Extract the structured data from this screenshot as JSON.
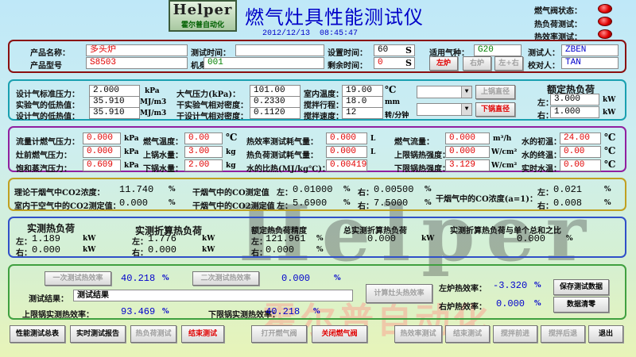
{
  "header": {
    "logo_text": "Helper",
    "logo_cn": "霍尔普自动化",
    "title": "燃气灶具性能测试仪",
    "datetime": "2012/12/13  08:45:47",
    "status": [
      "燃气阀状态：",
      "热负荷测试：",
      "热效率测试："
    ]
  },
  "info": {
    "product_name_label": "产品名称：",
    "product_name": "多头炉",
    "product_model_label": "产品型号",
    "product_model": "S8503",
    "test_time_label": "测试时间：",
    "test_time": "",
    "machine_no_label": "机身编号：",
    "machine_no": "001",
    "set_time_label": "设置时间：",
    "set_time": "60",
    "set_time_unit": "S",
    "remain_time_label": "剩余时间：",
    "remain_time": "0",
    "remain_time_unit": "S",
    "gas_label": "适用气种：",
    "gas": "G20",
    "tester_label": "测试人：",
    "tester": "ZBEN",
    "checker_label": "校对人：",
    "checker": "TAN",
    "btn_left": "左炉",
    "btn_right": "右炉",
    "btn_both": "左+右"
  },
  "params": {
    "design_pressure_label": "设计气标准压力：",
    "design_pressure": "2.000",
    "design_pressure_unit": "kPa",
    "exp_calorific_label": "实验气的低热值：",
    "exp_calorific": "35.910",
    "exp_calorific_unit": "MJ/m3",
    "design_calorific_label": "设计气的低热值：",
    "design_calorific": "35.910",
    "design_calorific_unit": "MJ/m3",
    "atm_label": "大气压力(kPa)：",
    "atm": "101.00",
    "dry_exp_density_label": "干实验气相对密度：",
    "dry_exp_density": "0.2330",
    "dry_design_density_label": "干设计气相对密度：",
    "dry_design_density": "0.1120",
    "room_temp_label": "室内温度：",
    "room_temp": "19.00",
    "room_temp_unit": "℃",
    "stir_travel_label": "搅拌行程：",
    "stir_travel": "18.0",
    "stir_travel_unit": "mm",
    "stir_speed_label": "搅拌速度：",
    "stir_speed": "12",
    "stir_speed_unit": "转/分钟",
    "upper_pot_btn": "上锅直径",
    "lower_pot_btn": "下锅直径",
    "rated_title": "额定热负荷",
    "rated_left_label": "左：",
    "rated_left": "3.000",
    "rated_unit": "kW",
    "rated_right_label": "右：",
    "rated_right": "1.000"
  },
  "measure": {
    "flow_pressure_label": "流量计燃气压力：",
    "flow_pressure": "0.000",
    "flow_pressure_unit": "kPa",
    "stove_pressure_label": "灶前燃气压力：",
    "stove_pressure": "0.000",
    "stove_pressure_unit": "kPa",
    "sat_pressure_label": "饱和蒸汽压力：",
    "sat_pressure": "0.609",
    "sat_pressure_unit": "kPa",
    "gas_temp_label": "燃气温度：",
    "gas_temp": "0.00",
    "gas_temp_unit": "℃",
    "upper_water_label": "上锅水量：",
    "upper_water": "3.00",
    "upper_water_unit": "kg",
    "lower_water_label": "下锅水量：",
    "lower_water": "2.00",
    "lower_water_unit": "kg",
    "eff_gas_label": "热效率测试耗气量：",
    "eff_gas": "0.000",
    "eff_gas_unit": "L",
    "load_gas_label": "热负荷测试耗气量：",
    "load_gas": "0.000",
    "load_gas_unit": "L",
    "specific_heat_label": "水的比热(MJ/kg℃)：",
    "specific_heat": "0.00419",
    "gas_flow_label": "燃气流量：",
    "gas_flow": "0.000",
    "gas_flow_unit": "m³/h",
    "upper_intensity_label": "上限锅热强度：",
    "upper_intensity": "0.000",
    "upper_intensity_unit": "W/cm²",
    "lower_intensity_label": "下限锅热强度：",
    "lower_intensity": "3.129",
    "lower_intensity_unit": "W/cm²",
    "water_init_label": "水的初温：",
    "water_init": "24.00",
    "water_init_unit": "℃",
    "water_final_label": "水的终温：",
    "water_final": "0.00",
    "water_final_unit": "℃",
    "real_water_label": "实时水温：",
    "real_water": "0.00",
    "real_water_unit": "℃"
  },
  "co": {
    "theory_co2_label": "理论干烟气中CO2浓度：",
    "theory_co2": "11.740",
    "pct": "%",
    "room_co2_label": "室内干空气中的CO2测定值：",
    "room_co2": "0.000",
    "co_label": "干烟气中的CO测定值",
    "co2_label": "干烟气中的CO2测定值",
    "left_label": "左：",
    "right_label": "右：",
    "co_left": "0.01000",
    "co_right": "0.00500",
    "co2_left": "5.6900",
    "co2_right": "7.5000",
    "co_a1_label": "干烟气中的CO浓度(a=1)：",
    "co_a1_left": "0.021",
    "co_a1_right": "0.008"
  },
  "heat": {
    "real_title": "实测热负荷",
    "real_left_label": "左：",
    "real_left": "1.189",
    "real_right_label": "右：",
    "real_right": "0.000",
    "unit": "kW",
    "conv_title": "实测折算热负荷",
    "conv_left": "1.776",
    "conv_right": "0.000",
    "precision_title": "额定热负荷精度",
    "precision_left": "121.961",
    "precision_right": "0.000",
    "pct": "%",
    "total_title": "总实测折算热负荷",
    "total": "0.000",
    "ratio_title": "实测折算热负荷与单个总和之比",
    "ratio": "0.000"
  },
  "eff": {
    "eff1_btn": "一次测试热效率",
    "eff1": "40.218",
    "pct": "%",
    "eff2_btn": "二次测试热效率",
    "eff2": "0.000",
    "result_label": "测试结果：",
    "result": "测试结果",
    "upper_eff_label": "上限锅实测热效率：",
    "upper_eff": "93.469",
    "lower_eff_label": "下限锅实测热效率：",
    "lower_eff": "40.218",
    "calc_btn": "计算灶头热效率",
    "left_drop_label": "左炉热效率：",
    "left_drop": "-3.320",
    "right_drop_label": "右炉热效率：",
    "right_drop": "0.000",
    "save_btn": "保存测试数据",
    "clear_btn": "数据清零"
  },
  "footer": {
    "summary": "性能测试总表",
    "realtime_report": "实时测试报告",
    "load_test": "热负荷测试",
    "end_test": "结束测试",
    "open_valve": "打开燃气阀",
    "close_valve": "关闭燃气阀",
    "eff_test": "热效率测试",
    "end_test2": "结束测试",
    "stir_forward": "搅拌前进",
    "stir_back": "搅拌后退",
    "exit": "退出"
  },
  "watermark": {
    "text": "Helper",
    "cn": "霍尔普自动化"
  }
}
